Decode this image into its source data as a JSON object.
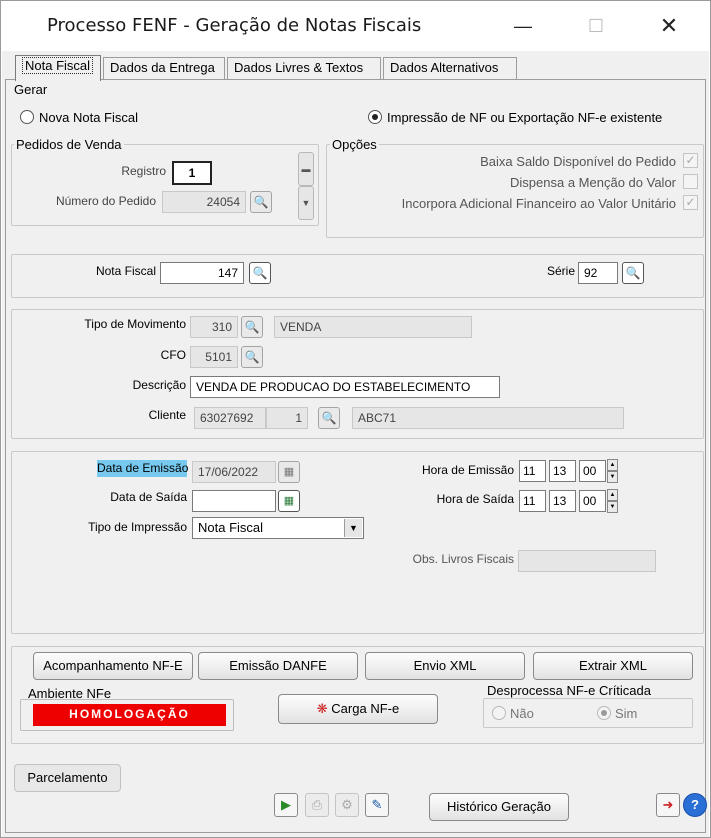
{
  "window": {
    "title": "Processo FENF - Geração de Notas Fiscais",
    "minimize_icon": "minimize-icon",
    "maximize_icon": "maximize-icon",
    "close_icon": "close-icon"
  },
  "tabs": [
    "Nota Fiscal",
    "Dados da Entrega",
    "Dados Livres & Textos",
    "Dados Alternativos"
  ],
  "gerar": {
    "label": "Gerar",
    "opt_nova": "Nova Nota Fiscal",
    "opt_impressao": "Impressão de NF ou Exportação NF-e existente",
    "selected": "opt_impressao"
  },
  "pedidos": {
    "label": "Pedidos de Venda",
    "registro_label": "Registro",
    "registro_value": "1",
    "numero_label": "Número do Pedido",
    "numero_value": "24054"
  },
  "opcoes": {
    "label": "Opções",
    "items": [
      {
        "label": "Baixa Saldo Disponível do Pedido",
        "checked": true
      },
      {
        "label": "Dispensa a Menção do Valor",
        "checked": false
      },
      {
        "label": "Incorpora Adicional Financeiro ao Valor Unitário",
        "checked": true
      }
    ]
  },
  "nf": {
    "nota_label": "Nota Fiscal",
    "nota_value": "147",
    "serie_label": "Série",
    "serie_value": "92"
  },
  "mov": {
    "tipo_label": "Tipo de Movimento",
    "tipo_code": "310",
    "tipo_desc": "VENDA",
    "cfo_label": "CFO",
    "cfo_value": "5101",
    "descricao_label": "Descrição",
    "descricao_value": "VENDA DE PRODUCAO DO ESTABELECIMENTO",
    "cliente_label": "Cliente",
    "cliente_code": "63027692",
    "cliente_seq": "1",
    "cliente_name": "ABC71"
  },
  "datas": {
    "emissao_label": "Data de Emissão",
    "emissao_value": "17/06/2022",
    "saida_label": "Data de Saída",
    "saida_value": "",
    "tipo_imp_label": "Tipo de Impressão",
    "tipo_imp_value": "Nota Fiscal",
    "hora_emissao_label": "Hora de Emissão",
    "hora_emissao": [
      "11",
      "13",
      "00"
    ],
    "hora_saida_label": "Hora de Saída",
    "hora_saida": [
      "11",
      "13",
      "00"
    ],
    "obs_label": "Obs. Livros Fiscais",
    "obs_value": ""
  },
  "actions": {
    "acompanhamento": "Acompanhamento NF-E",
    "emissao_danfe": "Emissão DANFE",
    "envio_xml": "Envio XML",
    "extrair_xml": "Extrair XML",
    "carga_nfe": "Carga NF-e",
    "parcelamento": "Parcelamento",
    "historico": "Histórico Geração"
  },
  "ambiente": {
    "label": "Ambiente NFe",
    "value": "HOMOLOGAÇÃO",
    "color": "#ee0000"
  },
  "desprocessa": {
    "label": "Desprocessa NF-e Críticada",
    "opt_nao": "Não",
    "opt_sim": "Sim",
    "selected": "opt_sim"
  },
  "colors": {
    "highlight": "#77c9ef",
    "window_bg": "#f0f0f0"
  }
}
